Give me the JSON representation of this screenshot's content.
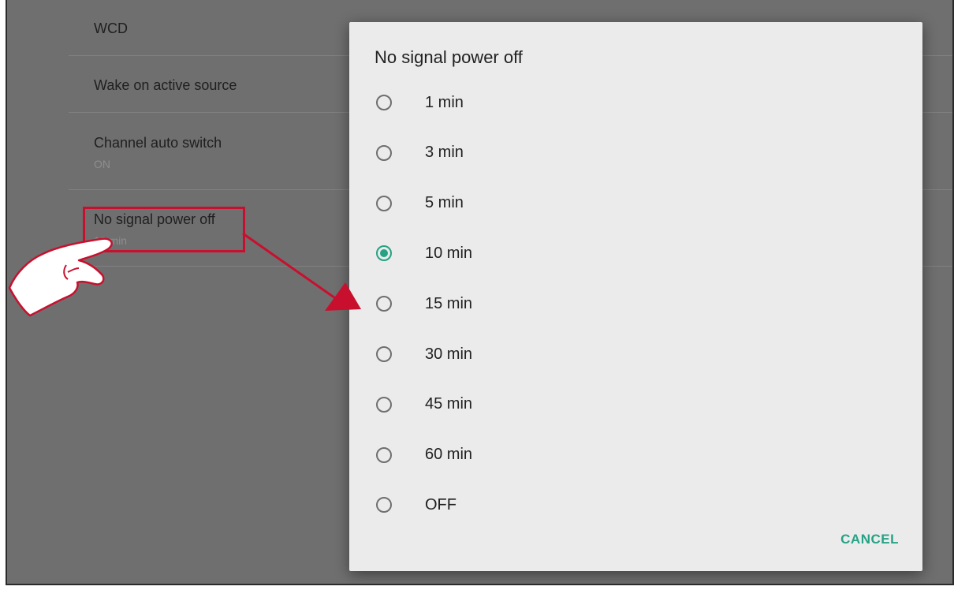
{
  "settings": {
    "rows": [
      {
        "title": "WCD",
        "value": ""
      },
      {
        "title": "Wake on active source",
        "value": ""
      },
      {
        "title": "Channel auto switch",
        "value": "ON"
      },
      {
        "title": "No signal power off",
        "value": "10 min"
      }
    ]
  },
  "dialog": {
    "title": "No signal power off",
    "options": [
      "1 min",
      "3 min",
      "5 min",
      "10 min",
      "15 min",
      "30 min",
      "45 min",
      "60 min",
      "OFF"
    ],
    "selected_index": 3,
    "cancel_label": "CANCEL"
  },
  "colors": {
    "accent": "#26a285",
    "annotation": "#c8102e",
    "scrim": "#6f6f6f",
    "dialog_bg": "#ebebeb"
  }
}
